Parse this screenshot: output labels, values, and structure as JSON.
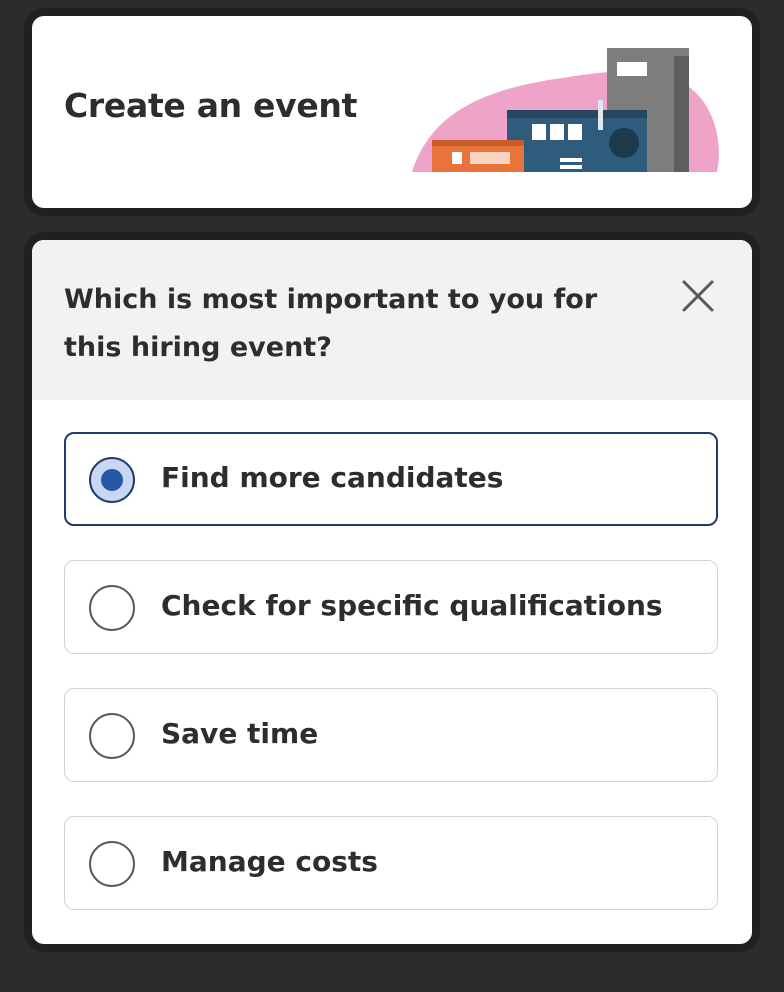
{
  "header": {
    "title": "Create an event"
  },
  "question": {
    "text": "Which is most important to you for this hiring event?",
    "close_icon": "close-icon"
  },
  "options": [
    {
      "label": "Find more candidates",
      "selected": true
    },
    {
      "label": "Check for specific qualifications",
      "selected": false
    },
    {
      "label": "Save time",
      "selected": false
    },
    {
      "label": "Manage costs",
      "selected": false
    }
  ],
  "colors": {
    "accent": "#2557a7",
    "selected_border": "#1f3a6b",
    "text": "#2d2d2d",
    "header_bg": "#f3f2f1"
  }
}
